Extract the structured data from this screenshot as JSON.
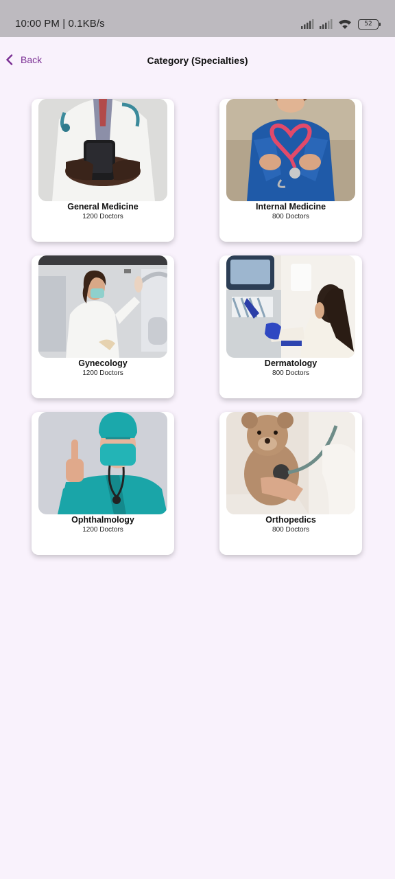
{
  "status_bar": {
    "time": "10:00 PM | 0.1KB/s",
    "battery_level": "52",
    "icons": [
      "signal-icon",
      "signal-icon",
      "wifi-icon",
      "battery-icon"
    ]
  },
  "header": {
    "back_label": "Back",
    "title": "Category (Specialties)",
    "accent_color": "#7a2e93"
  },
  "categories": [
    {
      "name": "General Medicine",
      "count": "1200 Doctors",
      "image": "doctor-holding-phone-photo"
    },
    {
      "name": "Internal Medicine",
      "count": "800 Doctors",
      "image": "stethoscope-heart-photo"
    },
    {
      "name": "Gynecology",
      "count": "1200 Doctors",
      "image": "doctor-with-mask-in-lab-photo"
    },
    {
      "name": "Dermatology",
      "count": "800 Doctors",
      "image": "lab-technician-gloves-photo"
    },
    {
      "name": "Ophthalmology",
      "count": "1200 Doctors",
      "image": "surgeon-thumbs-up-photo"
    },
    {
      "name": "Orthopedics",
      "count": "800 Doctors",
      "image": "teddy-bear-stethoscope-photo"
    }
  ]
}
